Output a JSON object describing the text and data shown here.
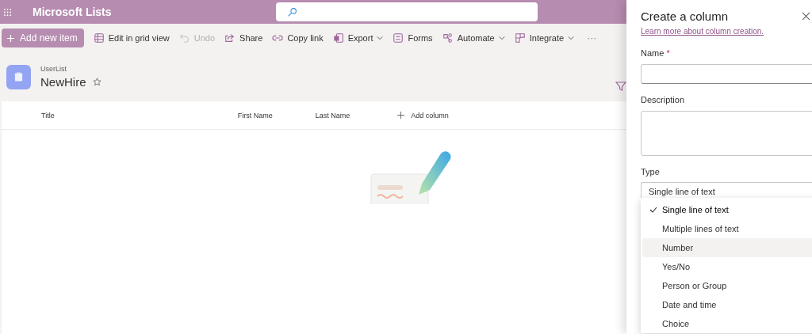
{
  "app_bar": {
    "title": "Microsoft Lists"
  },
  "toolbar": {
    "primary": "Add new item",
    "items": [
      {
        "label": "Edit in grid view",
        "disabled": false,
        "menu": false
      },
      {
        "label": "Undo",
        "disabled": true,
        "menu": false
      },
      {
        "label": "Share",
        "disabled": false,
        "menu": false
      },
      {
        "label": "Copy link",
        "disabled": false,
        "menu": false
      },
      {
        "label": "Export",
        "disabled": false,
        "menu": true
      },
      {
        "label": "Forms",
        "disabled": false,
        "menu": false
      },
      {
        "label": "Automate",
        "disabled": false,
        "menu": true
      },
      {
        "label": "Integrate",
        "disabled": false,
        "menu": true
      }
    ],
    "more": "···"
  },
  "list_header": {
    "parent": "UserList",
    "title": "NewHire",
    "favorite": false
  },
  "table": {
    "columns": [
      "Title",
      "First Name",
      "Last Name"
    ],
    "add_column": "Add column"
  },
  "panel": {
    "title": "Create a column",
    "link": "Learn more about column creation.",
    "name_label": "Name",
    "required_mark": "*",
    "description_label": "Description",
    "type_label": "Type",
    "type_value": "Single line of text",
    "type_options": [
      {
        "label": "Single line of text",
        "selected": true,
        "hovered": false
      },
      {
        "label": "Multiple lines of text",
        "selected": false,
        "hovered": false
      },
      {
        "label": "Number",
        "selected": false,
        "hovered": true
      },
      {
        "label": "Yes/No",
        "selected": false,
        "hovered": false
      },
      {
        "label": "Person or Group",
        "selected": false,
        "hovered": false
      },
      {
        "label": "Date and time",
        "selected": false,
        "hovered": false
      },
      {
        "label": "Choice",
        "selected": false,
        "hovered": false
      }
    ]
  }
}
